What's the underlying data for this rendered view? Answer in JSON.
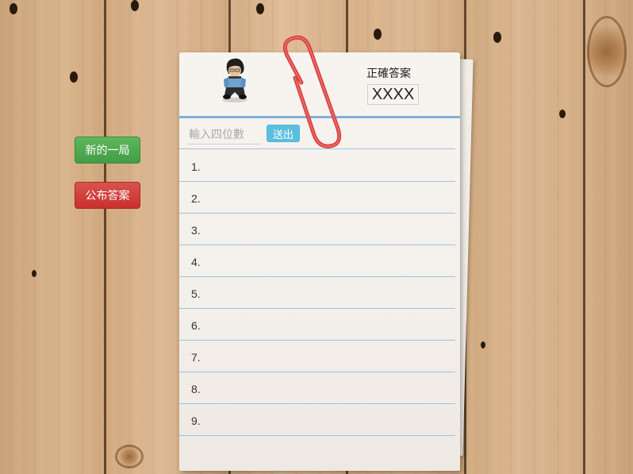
{
  "buttons": {
    "new_game": "新的一局",
    "reveal_answer": "公布答案"
  },
  "answer": {
    "label": "正確答案",
    "value": "XXXX"
  },
  "guess": {
    "placeholder": "輸入四位數",
    "value": "",
    "submit_label": "送出"
  },
  "rows": [
    "1.",
    "2.",
    "3.",
    "4.",
    "5.",
    "6.",
    "7.",
    "8.",
    "9."
  ],
  "colors": {
    "new_game_button": "#5cb85c",
    "reveal_button": "#d9534f",
    "submit_button": "#5bc0de",
    "ruled_line": "#9cc2e6",
    "paperclip": "#d9403f"
  },
  "icons": {
    "avatar": "cartoon-character-icon",
    "paperclip": "paperclip-icon"
  }
}
